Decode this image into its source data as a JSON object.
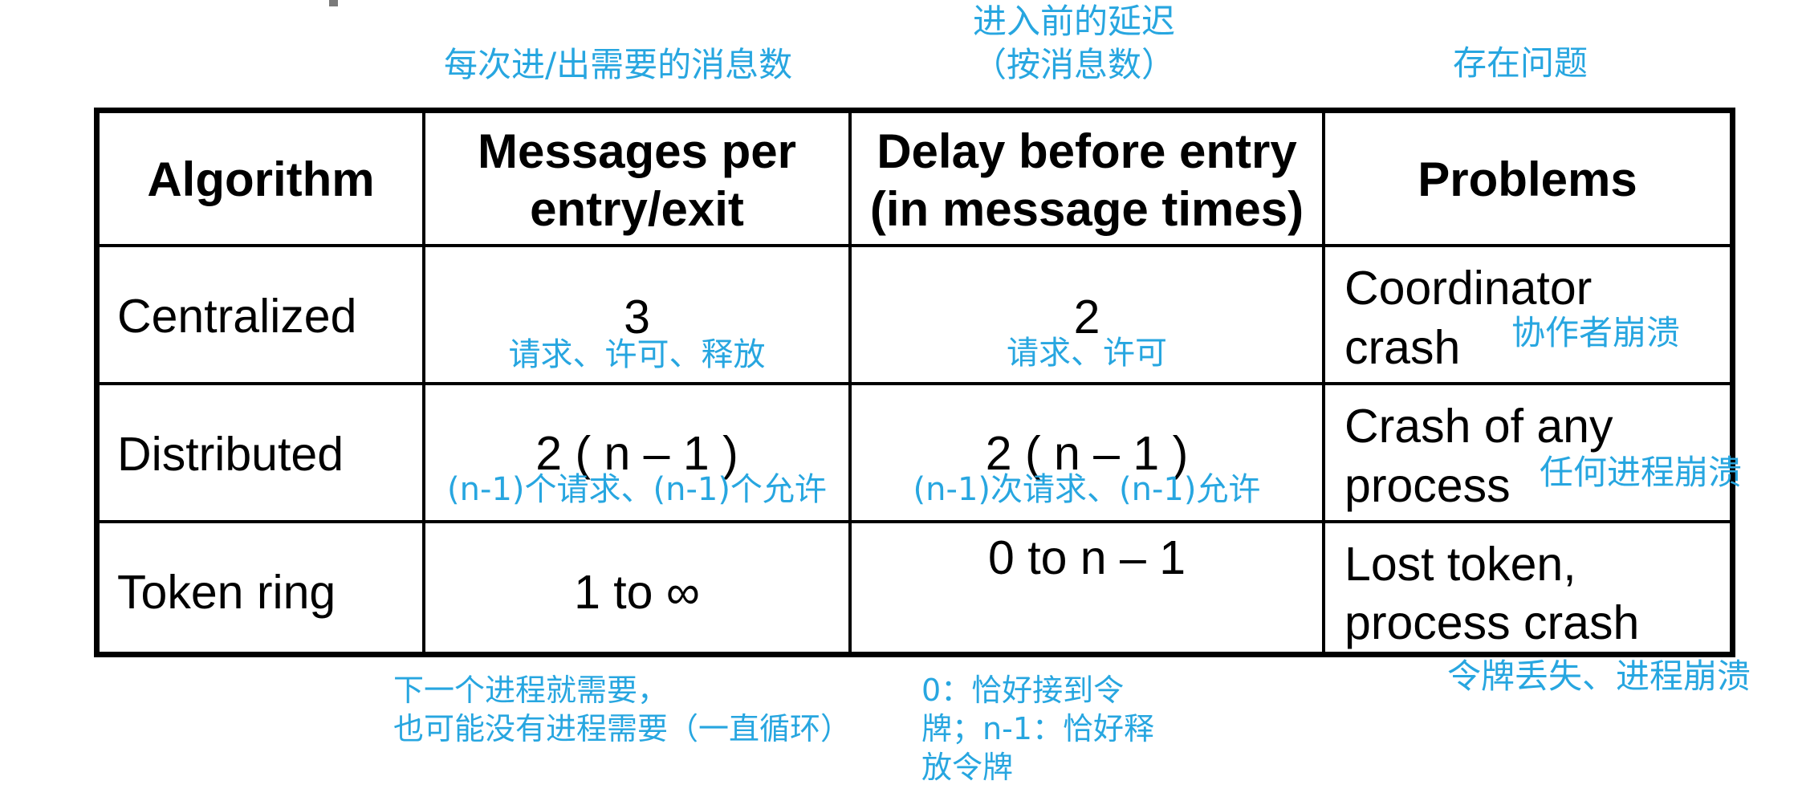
{
  "annotations": {
    "messages_header_cn": "每次进/出需要的消息数",
    "delay_header_cn_line1": "进入前的延迟",
    "delay_header_cn_line2": "（按消息数）",
    "problems_header_cn": "存在问题",
    "token_messages_cn_line1": "下一个进程就需要，",
    "token_messages_cn_line2": "也可能没有进程需要（一直循环）",
    "token_delay_cn_line1": "0：恰好接到令",
    "token_delay_cn_line2": "牌；n-1：恰好释",
    "token_delay_cn_line3": "放令牌",
    "token_problem_cn": "令牌丢失、进程崩溃"
  },
  "table": {
    "headers": {
      "algorithm": "Algorithm",
      "messages_line1": "Messages per",
      "messages_line2": "entry/exit",
      "delay_line1": "Delay before entry",
      "delay_line2": "(in message times)",
      "problems": "Problems"
    },
    "rows": [
      {
        "algorithm": "Centralized",
        "messages": "3",
        "messages_note": "请求、许可、释放",
        "delay": "2",
        "delay_note": "请求、许可",
        "problem_line1": "Coordinator",
        "problem_line2": "crash",
        "problem_note": "协作者崩溃"
      },
      {
        "algorithm": "Distributed",
        "messages": "2 ( n  –  1 )",
        "messages_note": "(n-1)个请求、(n-1)个允许",
        "delay": "2 ( n  –  1 )",
        "delay_note": "(n-1)次请求、(n-1)允许",
        "problem_line1": "Crash of any",
        "problem_line2": "process",
        "problem_note": "任何进程崩溃"
      },
      {
        "algorithm": "Token ring",
        "messages": "1 to ∞",
        "delay": "0 to n – 1",
        "problem_line1": "Lost token,",
        "problem_line2": "process crash"
      }
    ]
  }
}
